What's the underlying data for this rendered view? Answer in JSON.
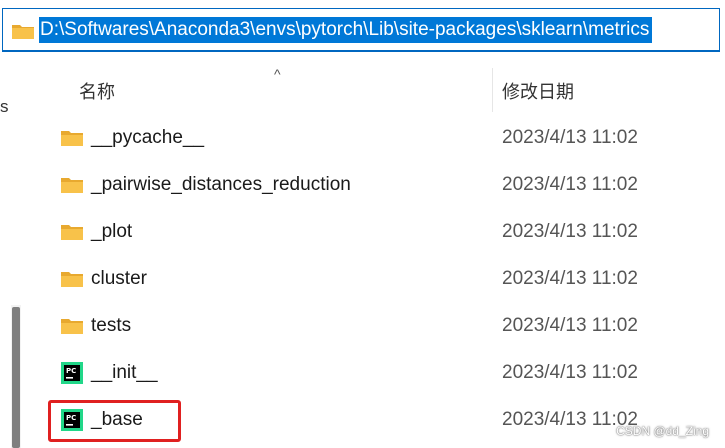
{
  "address": {
    "path": "D:\\Softwares\\Anaconda3\\envs\\pytorch\\Lib\\site-packages\\sklearn\\metrics"
  },
  "nav": {
    "partial_text": "s"
  },
  "header": {
    "name": "名称",
    "date_modified": "修改日期",
    "sort_indicator": "^"
  },
  "files": [
    {
      "name": "__pycache__",
      "type": "folder",
      "date": "2023/4/13 11:02"
    },
    {
      "name": "_pairwise_distances_reduction",
      "type": "folder",
      "date": "2023/4/13 11:02"
    },
    {
      "name": "_plot",
      "type": "folder",
      "date": "2023/4/13 11:02"
    },
    {
      "name": "cluster",
      "type": "folder",
      "date": "2023/4/13 11:02"
    },
    {
      "name": "tests",
      "type": "folder",
      "date": "2023/4/13 11:02"
    },
    {
      "name": "__init__",
      "type": "pycharm-file",
      "date": "2023/4/13 11:02"
    },
    {
      "name": "_base",
      "type": "pycharm-file",
      "date": "2023/4/13 11:02"
    }
  ],
  "colors": {
    "selection": "#0078d7",
    "folder": "#f8c24a",
    "highlight": "#e02020"
  },
  "watermark": "CSDN @dd_Zing"
}
